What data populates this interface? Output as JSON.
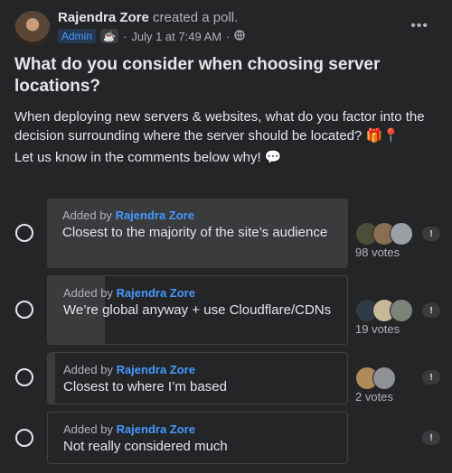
{
  "post": {
    "author": "Rajendra Zore",
    "action": "created a poll.",
    "role_badge": "Admin",
    "badge_icon": "coffee-cup-icon",
    "timestamp": "July 1 at 7:49 AM",
    "separator": "·",
    "privacy_icon": "globe-icon",
    "more_label": "•••",
    "title": "What do you consider when choosing server locations?",
    "description": "When deploying new servers & websites, what do you factor into the decision surrounding where the server should be located? 🎁📍",
    "cta": "Let us know in the comments below why! 💬"
  },
  "poll": {
    "options": [
      {
        "added_prefix": "Added by",
        "added_by": "Rajendra Zore",
        "label": "Closest to the majority of the site’s audience",
        "votes": "98 votes",
        "share": 1.0
      },
      {
        "added_prefix": "Added by",
        "added_by": "Rajendra Zore",
        "label": "We’re global anyway + use Cloudflare/CDNs",
        "votes": "19 votes",
        "share": 0.19
      },
      {
        "added_prefix": "Added by",
        "added_by": "Rajendra Zore",
        "label": "Closest to where I’m based",
        "votes": "2 votes",
        "share": 0.02
      },
      {
        "added_prefix": "Added by",
        "added_by": "Rajendra Zore",
        "label": "Not really considered much",
        "votes": "",
        "share": 0.0
      }
    ],
    "info_icon": "info-icon",
    "info_glyph": "!"
  },
  "colors": {
    "link": "#4599ff",
    "background": "#242526",
    "bar": "#3a3b3c"
  }
}
